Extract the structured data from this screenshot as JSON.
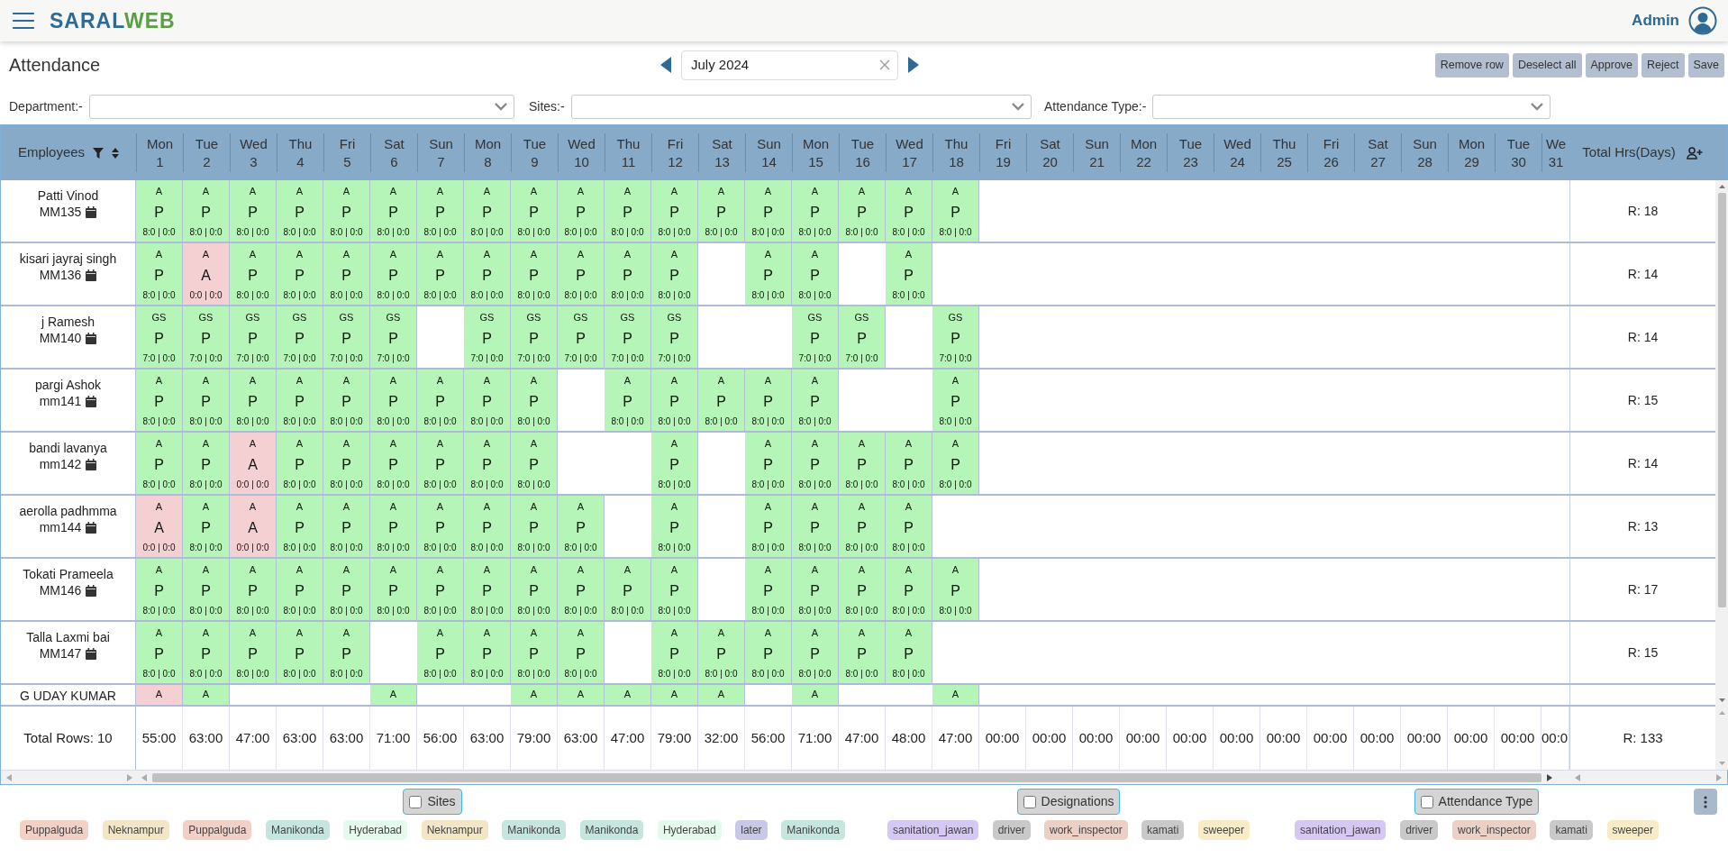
{
  "header": {
    "logo": {
      "primary": "SARAL",
      "accent": "WEB"
    },
    "user": "Admin"
  },
  "page": {
    "title": "Attendance",
    "month": "July 2024",
    "buttons": [
      "Remove row",
      "Deselect all",
      "Approve",
      "Reject",
      "Save"
    ]
  },
  "filters": [
    {
      "label": "Department:-"
    },
    {
      "label": "Sites:-"
    },
    {
      "label": "Attendance Type:-"
    }
  ],
  "table": {
    "employee_column": "Employees",
    "total_column": "Total Hrs(Days)",
    "days": [
      {
        "weekday": "Mon",
        "date": "1"
      },
      {
        "weekday": "Tue",
        "date": "2"
      },
      {
        "weekday": "Wed",
        "date": "3"
      },
      {
        "weekday": "Thu",
        "date": "4"
      },
      {
        "weekday": "Fri",
        "date": "5"
      },
      {
        "weekday": "Sat",
        "date": "6"
      },
      {
        "weekday": "Sun",
        "date": "7"
      },
      {
        "weekday": "Mon",
        "date": "8"
      },
      {
        "weekday": "Tue",
        "date": "9"
      },
      {
        "weekday": "Wed",
        "date": "10"
      },
      {
        "weekday": "Thu",
        "date": "11"
      },
      {
        "weekday": "Fri",
        "date": "12"
      },
      {
        "weekday": "Sat",
        "date": "13"
      },
      {
        "weekday": "Sun",
        "date": "14"
      },
      {
        "weekday": "Mon",
        "date": "15"
      },
      {
        "weekday": "Tue",
        "date": "16"
      },
      {
        "weekday": "Wed",
        "date": "17"
      },
      {
        "weekday": "Thu",
        "date": "18"
      },
      {
        "weekday": "Fri",
        "date": "19"
      },
      {
        "weekday": "Sat",
        "date": "20"
      },
      {
        "weekday": "Sun",
        "date": "21"
      },
      {
        "weekday": "Mon",
        "date": "22"
      },
      {
        "weekday": "Tue",
        "date": "23"
      },
      {
        "weekday": "Wed",
        "date": "24"
      },
      {
        "weekday": "Thu",
        "date": "25"
      },
      {
        "weekday": "Fri",
        "date": "26"
      },
      {
        "weekday": "Sat",
        "date": "27"
      },
      {
        "weekday": "Sun",
        "date": "28"
      },
      {
        "weekday": "Mon",
        "date": "29"
      },
      {
        "weekday": "Tue",
        "date": "30"
      },
      {
        "weekday": "We",
        "date": "31"
      }
    ],
    "rows": [
      {
        "kind": "full",
        "name": "Patti Vinod",
        "id": "MM135",
        "total": "R: 18",
        "cells": [
          {
            "kind": "present",
            "shift": "A",
            "status": "P",
            "hours": "8:0 | 0:0"
          },
          {
            "kind": "present",
            "shift": "A",
            "status": "P",
            "hours": "8:0 | 0:0"
          },
          {
            "kind": "present",
            "shift": "A",
            "status": "P",
            "hours": "8:0 | 0:0"
          },
          {
            "kind": "present",
            "shift": "A",
            "status": "P",
            "hours": "8:0 | 0:0"
          },
          {
            "kind": "present",
            "shift": "A",
            "status": "P",
            "hours": "8:0 | 0:0"
          },
          {
            "kind": "present",
            "shift": "A",
            "status": "P",
            "hours": "8:0 | 0:0"
          },
          {
            "kind": "present",
            "shift": "A",
            "status": "P",
            "hours": "8:0 | 0:0"
          },
          {
            "kind": "present",
            "shift": "A",
            "status": "P",
            "hours": "8:0 | 0:0"
          },
          {
            "kind": "present",
            "shift": "A",
            "status": "P",
            "hours": "8:0 | 0:0"
          },
          {
            "kind": "present",
            "shift": "A",
            "status": "P",
            "hours": "8:0 | 0:0"
          },
          {
            "kind": "present",
            "shift": "A",
            "status": "P",
            "hours": "8:0 | 0:0"
          },
          {
            "kind": "present",
            "shift": "A",
            "status": "P",
            "hours": "8:0 | 0:0"
          },
          {
            "kind": "present",
            "shift": "A",
            "status": "P",
            "hours": "8:0 | 0:0"
          },
          {
            "kind": "present",
            "shift": "A",
            "status": "P",
            "hours": "8:0 | 0:0"
          },
          {
            "kind": "present",
            "shift": "A",
            "status": "P",
            "hours": "8:0 | 0:0"
          },
          {
            "kind": "present",
            "shift": "A",
            "status": "P",
            "hours": "8:0 | 0:0"
          },
          {
            "kind": "present",
            "shift": "A",
            "status": "P",
            "hours": "8:0 | 0:0"
          },
          {
            "kind": "present",
            "shift": "A",
            "status": "P",
            "hours": "8:0 | 0:0"
          }
        ]
      },
      {
        "kind": "full",
        "name": "kisari jayraj singh",
        "id": "MM136",
        "total": "R: 14",
        "cells": [
          {
            "kind": "present",
            "shift": "A",
            "status": "P",
            "hours": "8:0 | 0:0"
          },
          {
            "kind": "absent",
            "shift": "A",
            "status": "A",
            "hours": "0:0 | 0:0"
          },
          {
            "kind": "present",
            "shift": "A",
            "status": "P",
            "hours": "8:0 | 0:0"
          },
          {
            "kind": "present",
            "shift": "A",
            "status": "P",
            "hours": "8:0 | 0:0"
          },
          {
            "kind": "present",
            "shift": "A",
            "status": "P",
            "hours": "8:0 | 0:0"
          },
          {
            "kind": "present",
            "shift": "A",
            "status": "P",
            "hours": "8:0 | 0:0"
          },
          {
            "kind": "present",
            "shift": "A",
            "status": "P",
            "hours": "8:0 | 0:0"
          },
          {
            "kind": "present",
            "shift": "A",
            "status": "P",
            "hours": "8:0 | 0:0"
          },
          {
            "kind": "present",
            "shift": "A",
            "status": "P",
            "hours": "8:0 | 0:0"
          },
          {
            "kind": "present",
            "shift": "A",
            "status": "P",
            "hours": "8:0 | 0:0"
          },
          {
            "kind": "present",
            "shift": "A",
            "status": "P",
            "hours": "8:0 | 0:0"
          },
          {
            "kind": "present",
            "shift": "A",
            "status": "P",
            "hours": "8:0 | 0:0"
          },
          {
            "kind": "blank"
          },
          {
            "kind": "present",
            "shift": "A",
            "status": "P",
            "hours": "8:0 | 0:0"
          },
          {
            "kind": "present",
            "shift": "A",
            "status": "P",
            "hours": "8:0 | 0:0"
          },
          {
            "kind": "blank"
          },
          {
            "kind": "present",
            "shift": "A",
            "status": "P",
            "hours": "8:0 | 0:0"
          }
        ]
      },
      {
        "kind": "full",
        "name": "j Ramesh",
        "id": "MM140",
        "total": "R: 14",
        "cells": [
          {
            "kind": "present",
            "shift": "GS",
            "status": "P",
            "hours": "7:0 | 0:0"
          },
          {
            "kind": "present",
            "shift": "GS",
            "status": "P",
            "hours": "7:0 | 0:0"
          },
          {
            "kind": "present",
            "shift": "GS",
            "status": "P",
            "hours": "7:0 | 0:0"
          },
          {
            "kind": "present",
            "shift": "GS",
            "status": "P",
            "hours": "7:0 | 0:0"
          },
          {
            "kind": "present",
            "shift": "GS",
            "status": "P",
            "hours": "7:0 | 0:0"
          },
          {
            "kind": "present",
            "shift": "GS",
            "status": "P",
            "hours": "7:0 | 0:0"
          },
          {
            "kind": "blank"
          },
          {
            "kind": "present",
            "shift": "GS",
            "status": "P",
            "hours": "7:0 | 0:0"
          },
          {
            "kind": "present",
            "shift": "GS",
            "status": "P",
            "hours": "7:0 | 0:0"
          },
          {
            "kind": "present",
            "shift": "GS",
            "status": "P",
            "hours": "7:0 | 0:0"
          },
          {
            "kind": "present",
            "shift": "GS",
            "status": "P",
            "hours": "7:0 | 0:0"
          },
          {
            "kind": "present",
            "shift": "GS",
            "status": "P",
            "hours": "7:0 | 0:0"
          },
          {
            "kind": "blank"
          },
          {
            "kind": "blank"
          },
          {
            "kind": "present",
            "shift": "GS",
            "status": "P",
            "hours": "7:0 | 0:0"
          },
          {
            "kind": "present",
            "shift": "GS",
            "status": "P",
            "hours": "7:0 | 0:0"
          },
          {
            "kind": "blank"
          },
          {
            "kind": "present",
            "shift": "GS",
            "status": "P",
            "hours": "7:0 | 0:0"
          }
        ]
      },
      {
        "kind": "full",
        "name": "pargi Ashok",
        "id": "mm141",
        "total": "R: 15",
        "cells": [
          {
            "kind": "present",
            "shift": "A",
            "status": "P",
            "hours": "8:0 | 0:0"
          },
          {
            "kind": "present",
            "shift": "A",
            "status": "P",
            "hours": "8:0 | 0:0"
          },
          {
            "kind": "present",
            "shift": "A",
            "status": "P",
            "hours": "8:0 | 0:0"
          },
          {
            "kind": "present",
            "shift": "A",
            "status": "P",
            "hours": "8:0 | 0:0"
          },
          {
            "kind": "present",
            "shift": "A",
            "status": "P",
            "hours": "8:0 | 0:0"
          },
          {
            "kind": "present",
            "shift": "A",
            "status": "P",
            "hours": "8:0 | 0:0"
          },
          {
            "kind": "present",
            "shift": "A",
            "status": "P",
            "hours": "8:0 | 0:0"
          },
          {
            "kind": "present",
            "shift": "A",
            "status": "P",
            "hours": "8:0 | 0:0"
          },
          {
            "kind": "present",
            "shift": "A",
            "status": "P",
            "hours": "8:0 | 0:0"
          },
          {
            "kind": "blank"
          },
          {
            "kind": "present",
            "shift": "A",
            "status": "P",
            "hours": "8:0 | 0:0"
          },
          {
            "kind": "present",
            "shift": "A",
            "status": "P",
            "hours": "8:0 | 0:0"
          },
          {
            "kind": "present",
            "shift": "A",
            "status": "P",
            "hours": "8:0 | 0:0"
          },
          {
            "kind": "present",
            "shift": "A",
            "status": "P",
            "hours": "8:0 | 0:0"
          },
          {
            "kind": "present",
            "shift": "A",
            "status": "P",
            "hours": "8:0 | 0:0"
          },
          {
            "kind": "blank"
          },
          {
            "kind": "blank"
          },
          {
            "kind": "present",
            "shift": "A",
            "status": "P",
            "hours": "8:0 | 0:0"
          }
        ]
      },
      {
        "kind": "full",
        "name": "bandi lavanya",
        "id": "mm142",
        "total": "R: 14",
        "cells": [
          {
            "kind": "present",
            "shift": "A",
            "status": "P",
            "hours": "8:0 | 0:0"
          },
          {
            "kind": "present",
            "shift": "A",
            "status": "P",
            "hours": "8:0 | 0:0"
          },
          {
            "kind": "absent",
            "shift": "A",
            "status": "A",
            "hours": "0:0 | 0:0"
          },
          {
            "kind": "present",
            "shift": "A",
            "status": "P",
            "hours": "8:0 | 0:0"
          },
          {
            "kind": "present",
            "shift": "A",
            "status": "P",
            "hours": "8:0 | 0:0"
          },
          {
            "kind": "present",
            "shift": "A",
            "status": "P",
            "hours": "8:0 | 0:0"
          },
          {
            "kind": "present",
            "shift": "A",
            "status": "P",
            "hours": "8:0 | 0:0"
          },
          {
            "kind": "present",
            "shift": "A",
            "status": "P",
            "hours": "8:0 | 0:0"
          },
          {
            "kind": "present",
            "shift": "A",
            "status": "P",
            "hours": "8:0 | 0:0"
          },
          {
            "kind": "blank"
          },
          {
            "kind": "blank"
          },
          {
            "kind": "present",
            "shift": "A",
            "status": "P",
            "hours": "8:0 | 0:0"
          },
          {
            "kind": "blank"
          },
          {
            "kind": "present",
            "shift": "A",
            "status": "P",
            "hours": "8:0 | 0:0"
          },
          {
            "kind": "present",
            "shift": "A",
            "status": "P",
            "hours": "8:0 | 0:0"
          },
          {
            "kind": "present",
            "shift": "A",
            "status": "P",
            "hours": "8:0 | 0:0"
          },
          {
            "kind": "present",
            "shift": "A",
            "status": "P",
            "hours": "8:0 | 0:0"
          },
          {
            "kind": "present",
            "shift": "A",
            "status": "P",
            "hours": "8:0 | 0:0"
          }
        ]
      },
      {
        "kind": "full",
        "name": "aerolla padhmma",
        "id": "mm144",
        "total": "R: 13",
        "cells": [
          {
            "kind": "absent",
            "shift": "A",
            "status": "A",
            "hours": "0:0 | 0:0"
          },
          {
            "kind": "present",
            "shift": "A",
            "status": "P",
            "hours": "8:0 | 0:0"
          },
          {
            "kind": "absent",
            "shift": "A",
            "status": "A",
            "hours": "0:0 | 0:0"
          },
          {
            "kind": "present",
            "shift": "A",
            "status": "P",
            "hours": "8:0 | 0:0"
          },
          {
            "kind": "present",
            "shift": "A",
            "status": "P",
            "hours": "8:0 | 0:0"
          },
          {
            "kind": "present",
            "shift": "A",
            "status": "P",
            "hours": "8:0 | 0:0"
          },
          {
            "kind": "present",
            "shift": "A",
            "status": "P",
            "hours": "8:0 | 0:0"
          },
          {
            "kind": "present",
            "shift": "A",
            "status": "P",
            "hours": "8:0 | 0:0"
          },
          {
            "kind": "present",
            "shift": "A",
            "status": "P",
            "hours": "8:0 | 0:0"
          },
          {
            "kind": "present",
            "shift": "A",
            "status": "P",
            "hours": "8:0 | 0:0"
          },
          {
            "kind": "blank"
          },
          {
            "kind": "present",
            "shift": "A",
            "status": "P",
            "hours": "8:0 | 0:0"
          },
          {
            "kind": "blank"
          },
          {
            "kind": "present",
            "shift": "A",
            "status": "P",
            "hours": "8:0 | 0:0"
          },
          {
            "kind": "present",
            "shift": "A",
            "status": "P",
            "hours": "8:0 | 0:0"
          },
          {
            "kind": "present",
            "shift": "A",
            "status": "P",
            "hours": "8:0 | 0:0"
          },
          {
            "kind": "present",
            "shift": "A",
            "status": "P",
            "hours": "8:0 | 0:0"
          }
        ]
      },
      {
        "kind": "full",
        "name": "Tokati Prameela",
        "id": "MM146",
        "total": "R: 17",
        "cells": [
          {
            "kind": "present",
            "shift": "A",
            "status": "P",
            "hours": "8:0 | 0:0"
          },
          {
            "kind": "present",
            "shift": "A",
            "status": "P",
            "hours": "8:0 | 0:0"
          },
          {
            "kind": "present",
            "shift": "A",
            "status": "P",
            "hours": "8:0 | 0:0"
          },
          {
            "kind": "present",
            "shift": "A",
            "status": "P",
            "hours": "8:0 | 0:0"
          },
          {
            "kind": "present",
            "shift": "A",
            "status": "P",
            "hours": "8:0 | 0:0"
          },
          {
            "kind": "present",
            "shift": "A",
            "status": "P",
            "hours": "8:0 | 0:0"
          },
          {
            "kind": "present",
            "shift": "A",
            "status": "P",
            "hours": "8:0 | 0:0"
          },
          {
            "kind": "present",
            "shift": "A",
            "status": "P",
            "hours": "8:0 | 0:0"
          },
          {
            "kind": "present",
            "shift": "A",
            "status": "P",
            "hours": "8:0 | 0:0"
          },
          {
            "kind": "present",
            "shift": "A",
            "status": "P",
            "hours": "8:0 | 0:0"
          },
          {
            "kind": "present",
            "shift": "A",
            "status": "P",
            "hours": "8:0 | 0:0"
          },
          {
            "kind": "present",
            "shift": "A",
            "status": "P",
            "hours": "8:0 | 0:0"
          },
          {
            "kind": "blank"
          },
          {
            "kind": "present",
            "shift": "A",
            "status": "P",
            "hours": "8:0 | 0:0"
          },
          {
            "kind": "present",
            "shift": "A",
            "status": "P",
            "hours": "8:0 | 0:0"
          },
          {
            "kind": "present",
            "shift": "A",
            "status": "P",
            "hours": "8:0 | 0:0"
          },
          {
            "kind": "present",
            "shift": "A",
            "status": "P",
            "hours": "8:0 | 0:0"
          },
          {
            "kind": "present",
            "shift": "A",
            "status": "P",
            "hours": "8:0 | 0:0"
          }
        ]
      },
      {
        "kind": "full",
        "name": "Talla Laxmi bai",
        "id": "MM147",
        "total": "R: 15",
        "cells": [
          {
            "kind": "present",
            "shift": "A",
            "status": "P",
            "hours": "8:0 | 0:0"
          },
          {
            "kind": "present",
            "shift": "A",
            "status": "P",
            "hours": "8:0 | 0:0"
          },
          {
            "kind": "present",
            "shift": "A",
            "status": "P",
            "hours": "8:0 | 0:0"
          },
          {
            "kind": "present",
            "shift": "A",
            "status": "P",
            "hours": "8:0 | 0:0"
          },
          {
            "kind": "present",
            "shift": "A",
            "status": "P",
            "hours": "8:0 | 0:0"
          },
          {
            "kind": "blank"
          },
          {
            "kind": "present",
            "shift": "A",
            "status": "P",
            "hours": "8:0 | 0:0"
          },
          {
            "kind": "present",
            "shift": "A",
            "status": "P",
            "hours": "8:0 | 0:0"
          },
          {
            "kind": "present",
            "shift": "A",
            "status": "P",
            "hours": "8:0 | 0:0"
          },
          {
            "kind": "present",
            "shift": "A",
            "status": "P",
            "hours": "8:0 | 0:0"
          },
          {
            "kind": "blank"
          },
          {
            "kind": "present",
            "shift": "A",
            "status": "P",
            "hours": "8:0 | 0:0"
          },
          {
            "kind": "present",
            "shift": "A",
            "status": "P",
            "hours": "8:0 | 0:0"
          },
          {
            "kind": "present",
            "shift": "A",
            "status": "P",
            "hours": "8:0 | 0:0"
          },
          {
            "kind": "present",
            "shift": "A",
            "status": "P",
            "hours": "8:0 | 0:0"
          },
          {
            "kind": "present",
            "shift": "A",
            "status": "P",
            "hours": "8:0 | 0:0"
          },
          {
            "kind": "present",
            "shift": "A",
            "status": "P",
            "hours": "8:0 | 0:0"
          }
        ]
      },
      {
        "kind": "cut",
        "name": "G UDAY KUMAR",
        "cells": [
          {
            "kind": "absent",
            "shift": "A"
          },
          {
            "kind": "present",
            "shift": "A"
          },
          {
            "kind": "blank"
          },
          {
            "kind": "blank"
          },
          {
            "kind": "blank"
          },
          {
            "kind": "present",
            "shift": "A"
          },
          {
            "kind": "blank"
          },
          {
            "kind": "blank"
          },
          {
            "kind": "present",
            "shift": "A"
          },
          {
            "kind": "present",
            "shift": "A"
          },
          {
            "kind": "present",
            "shift": "A"
          },
          {
            "kind": "present",
            "shift": "A"
          },
          {
            "kind": "present",
            "shift": "A"
          },
          {
            "kind": "blank"
          },
          {
            "kind": "present",
            "shift": "A"
          },
          {
            "kind": "blank"
          },
          {
            "kind": "blank"
          },
          {
            "kind": "present",
            "shift": "A"
          }
        ]
      }
    ],
    "totals": {
      "label": "Total Rows: 10",
      "values": [
        "55:00",
        "63:00",
        "47:00",
        "63:00",
        "63:00",
        "71:00",
        "56:00",
        "63:00",
        "79:00",
        "63:00",
        "47:00",
        "79:00",
        "32:00",
        "56:00",
        "71:00",
        "47:00",
        "48:00",
        "47:00",
        "00:00",
        "00:00",
        "00:00",
        "00:00",
        "00:00",
        "00:00",
        "00:00",
        "00:00",
        "00:00",
        "00:00",
        "00:00",
        "00:00",
        "00:0"
      ],
      "total": "R: 133"
    }
  },
  "legend_groups": [
    {
      "title": "Sites",
      "checked": false,
      "chips": [
        {
          "label": "Puppalguda",
          "color": "#f2d0c5"
        },
        {
          "label": "Neknampur",
          "color": "#f3e6c6"
        },
        {
          "label": "Puppalguda",
          "color": "#f2d0c5"
        },
        {
          "label": "Manikonda",
          "color": "#c4e6df"
        },
        {
          "label": "Hyderabad",
          "color": "#e3faec"
        },
        {
          "label": "Neknampur",
          "color": "#f3e6c6"
        },
        {
          "label": "Manikonda",
          "color": "#c4e6df"
        },
        {
          "label": "Manikonda",
          "color": "#c4e6df"
        },
        {
          "label": "Hyderabad",
          "color": "#e3faec"
        },
        {
          "label": "later",
          "color": "#c9c8e6"
        },
        {
          "label": "Manikonda",
          "color": "#c4e6df"
        }
      ]
    },
    {
      "title": "Designations",
      "checked": false,
      "chips": [
        {
          "label": "sanitation_jawan",
          "color": "#d6c8f5"
        },
        {
          "label": "driver",
          "color": "#c9c9c9"
        },
        {
          "label": "work_inspector",
          "color": "#ebd0c6"
        },
        {
          "label": "kamati",
          "color": "#c9c9c9"
        },
        {
          "label": "sweeper",
          "color": "#f8ecc6"
        }
      ]
    },
    {
      "title": "Attendance Type",
      "checked": false,
      "chips": [
        {
          "label": "sanitation_jawan",
          "color": "#d6c8f5"
        },
        {
          "label": "driver",
          "color": "#c9c9c9"
        },
        {
          "label": "work_inspector",
          "color": "#ebd0c6"
        },
        {
          "label": "kamati",
          "color": "#c9c9c9"
        },
        {
          "label": "sweeper",
          "color": "#f8ecc6"
        }
      ]
    }
  ]
}
